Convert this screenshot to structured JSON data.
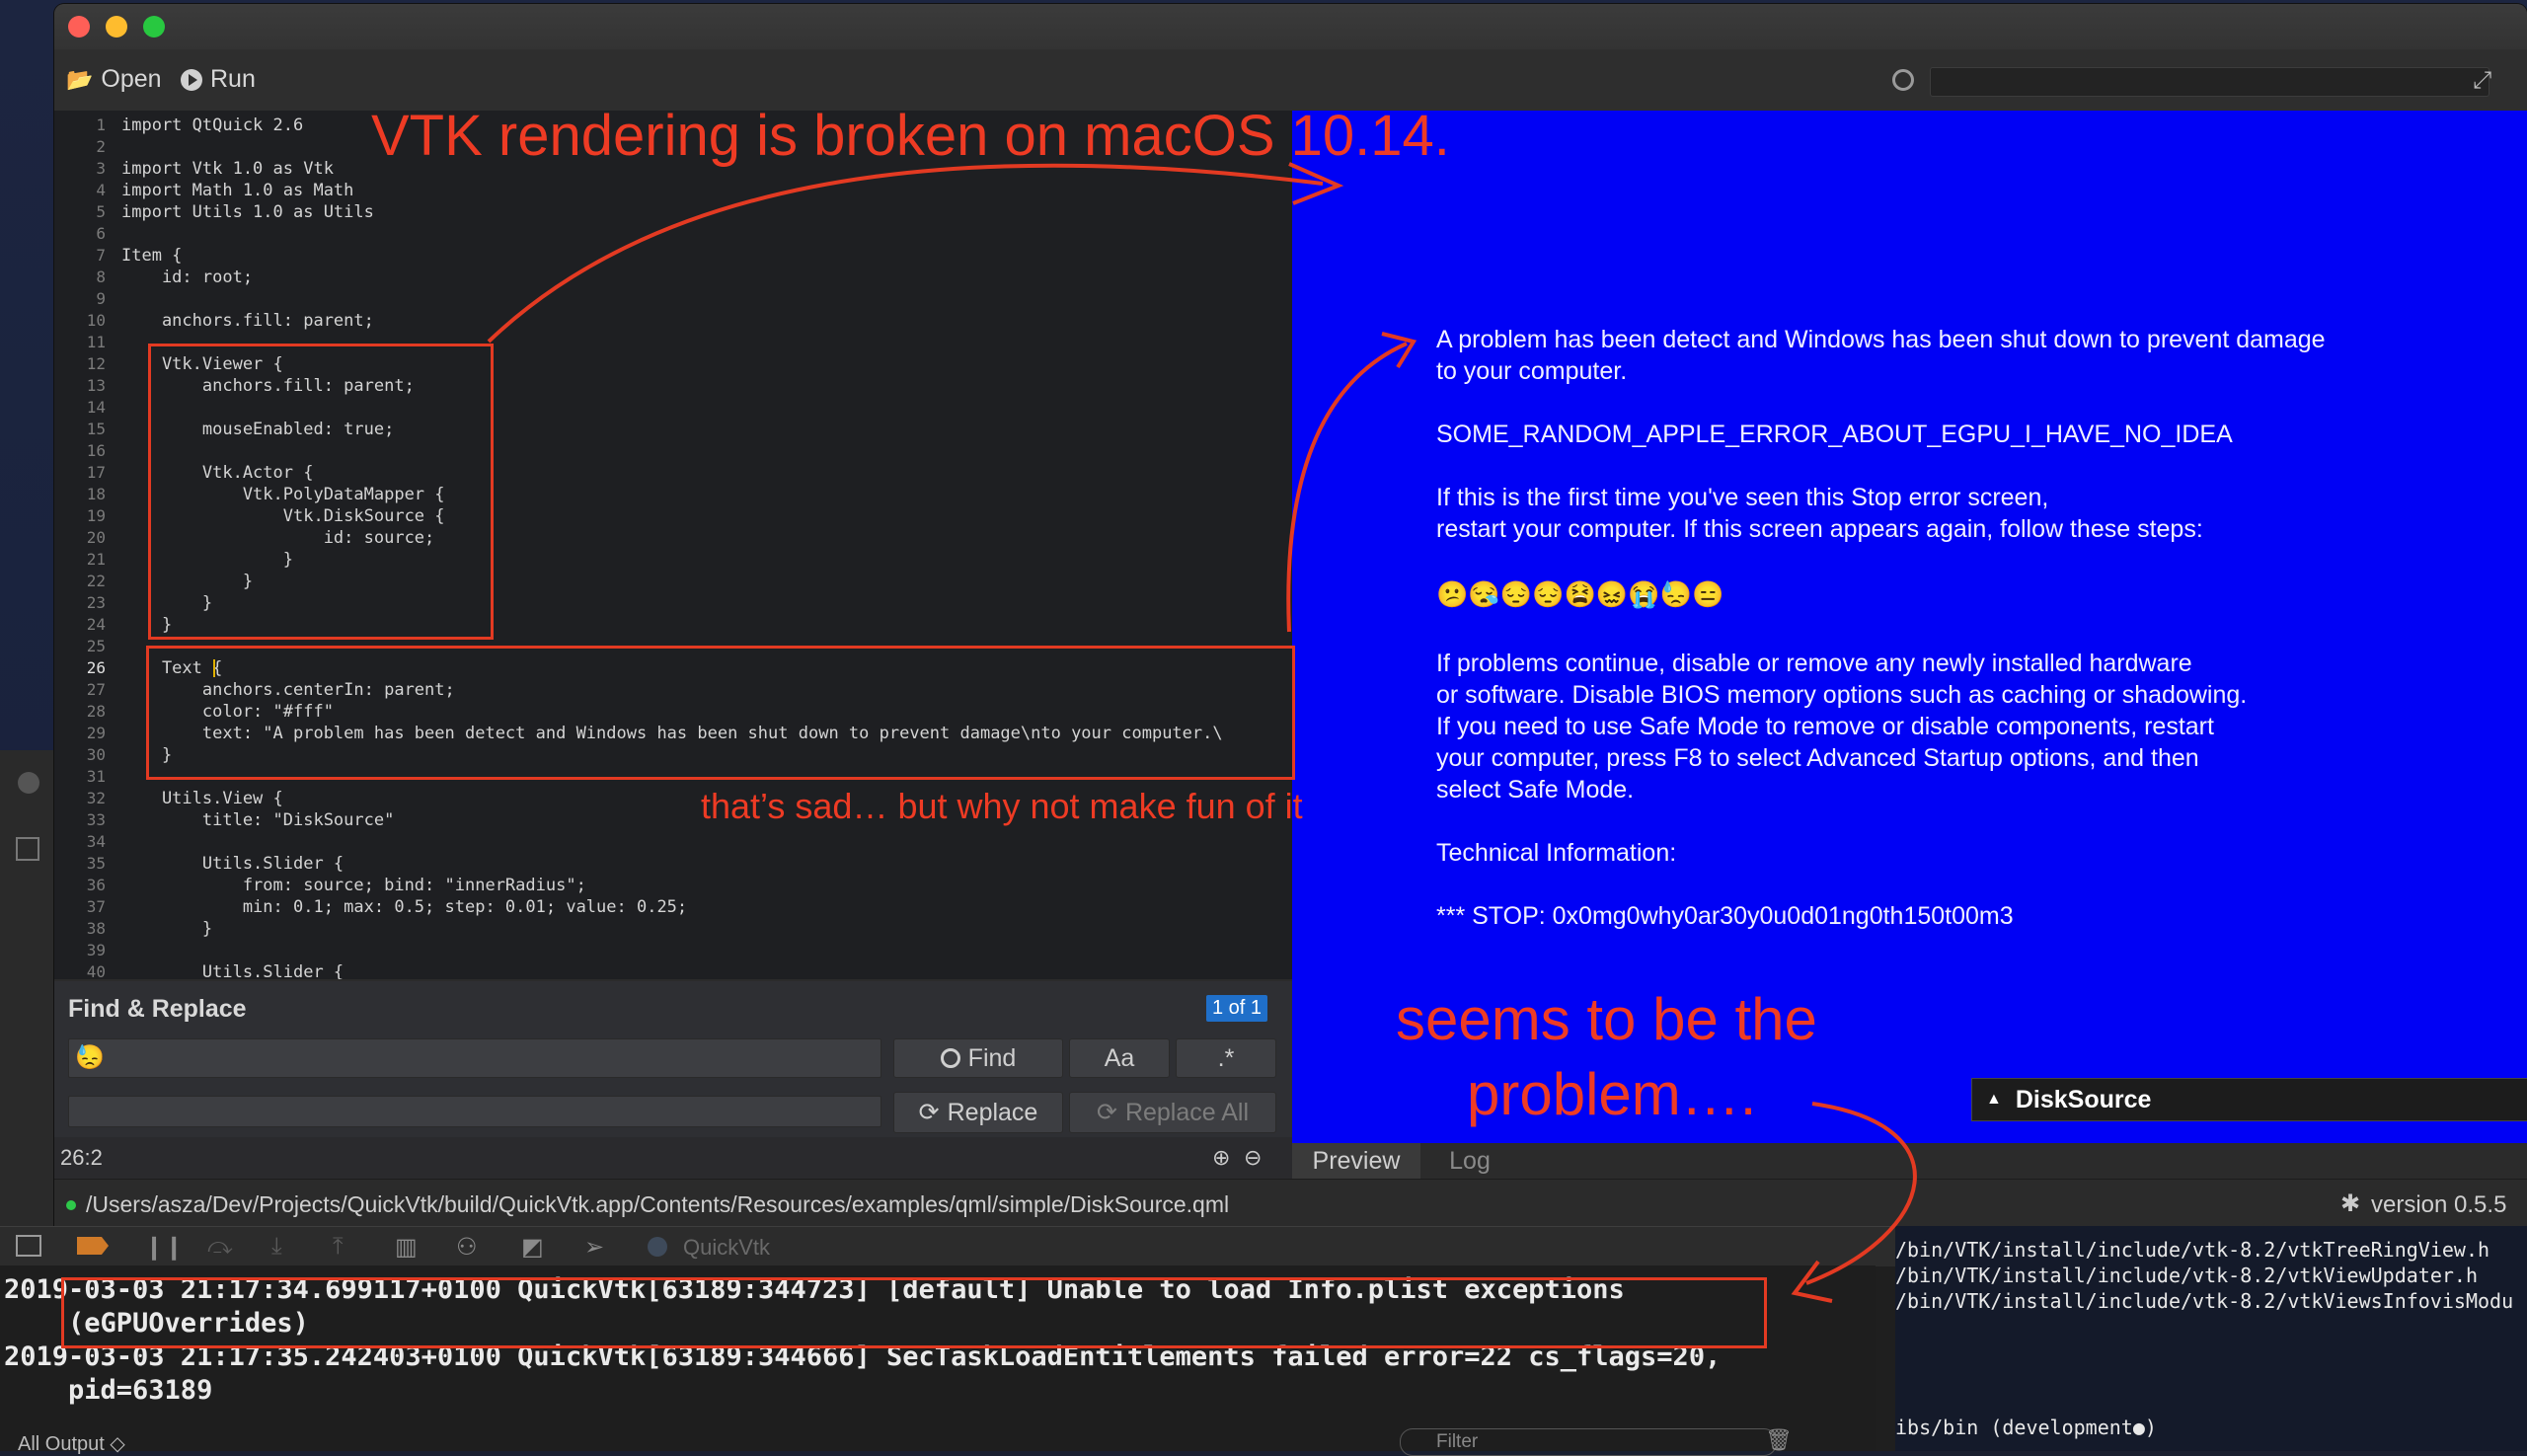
{
  "window": {
    "toolbar": {
      "open_label": "Open",
      "run_label": "Run"
    },
    "search_placeholder": ""
  },
  "editor": {
    "lines": [
      "import QtQuick 2.6",
      "",
      "import Vtk 1.0 as Vtk",
      "import Math 1.0 as Math",
      "import Utils 1.0 as Utils",
      "",
      "Item {",
      "    id: root;",
      "",
      "    anchors.fill: parent;",
      "",
      "    Vtk.Viewer {",
      "        anchors.fill: parent;",
      "",
      "        mouseEnabled: true;",
      "",
      "        Vtk.Actor {",
      "            Vtk.PolyDataMapper {",
      "                Vtk.DiskSource {",
      "                    id: source;",
      "                }",
      "            }",
      "        }",
      "    }",
      "",
      "    Text {",
      "        anchors.centerIn: parent;",
      "        color: \"#fff\"",
      "        text: \"A problem has been detect and Windows has been shut down to prevent damage\\nto your computer.\\",
      "    }",
      "",
      "    Utils.View {",
      "        title: \"DiskSource\"",
      "",
      "        Utils.Slider {",
      "            from: source; bind: \"innerRadius\";",
      "            min: 0.1; max: 0.5; step: 0.01; value: 0.25;",
      "        }",
      "",
      "        Utils.Slider {"
    ],
    "current_line": 26
  },
  "find_replace": {
    "title": "Find & Replace",
    "match_badge": "1 of 1",
    "find_value": "😓",
    "replace_value": "",
    "find_label": "Find",
    "case_label": "Aa",
    "regex_label": ".*",
    "replace_label": "Replace",
    "replace_all_label": "Replace All"
  },
  "status": {
    "cursor": "26:2"
  },
  "preview": {
    "bsod": {
      "line1": "A problem has been detect and Windows has been shut down to prevent damage",
      "line2": "to your computer.",
      "error_code": "SOME_RANDOM_APPLE_ERROR_ABOUT_EGPU_I_HAVE_NO_IDEA",
      "first_time1": "If this is the first time you've seen this Stop error screen,",
      "first_time2": "restart your computer. If this screen appears again, follow these steps:",
      "emoji": "😕😪😔😔😫😖😭😓😑",
      "cont1": "If problems continue, disable or remove any newly installed hardware",
      "cont2": "or software. Disable BIOS memory options such as caching or shadowing.",
      "cont3": "If you need to use Safe Mode to remove or disable components, restart",
      "cont4": "your computer, press F8 to select Advanced Startup options, and then",
      "cont5": "select Safe Mode.",
      "tech": "Technical Information:",
      "stop": "*** STOP: 0x0mg0why0ar30y0u0d01ng0th150t00m3"
    },
    "dropdown_label": "DiskSource",
    "tabs": {
      "preview": "Preview",
      "log": "Log"
    }
  },
  "pathbar": {
    "path": "/Users/asza/Dev/Projects/QuickVtk/build/QuickVtk.app/Contents/Resources/examples/qml/simple/DiskSource.qml",
    "version": "version 0.5.5"
  },
  "xcode": {
    "scheme": "QuickVtk",
    "console_lines": [
      "2019-03-03 21:17:34.699117+0100 QuickVtk[63189:344723] [default] Unable to load Info.plist exceptions",
      "    (eGPUOverrides)",
      "2019-03-03 21:17:35.242403+0100 QuickVtk[63189:344666] SecTaskLoadEntitlements failed error=22 cs_flags=20,",
      "    pid=63189"
    ],
    "output_filter": "All Output ◇",
    "filter_placeholder": "Filter"
  },
  "terminal": {
    "lines": [
      "/bin/VTK/install/include/vtk-8.2/vtkTreeRingView.h",
      "/bin/VTK/install/include/vtk-8.2/vtkViewUpdater.h",
      "/bin/VTK/install/include/vtk-8.2/vtkViewsInfovisModu",
      "ibs/bin (development●)"
    ]
  },
  "annotations": {
    "title": "VTK rendering is broken on macOS 10.14.",
    "sad": "that’s sad… but why not make fun of it",
    "problem1": "seems to be the",
    "problem2": "problem…."
  },
  "colors": {
    "bsod_blue": "#0001f5",
    "annotation_red": "#ee3b24",
    "editor_bg": "#1e1f22"
  }
}
